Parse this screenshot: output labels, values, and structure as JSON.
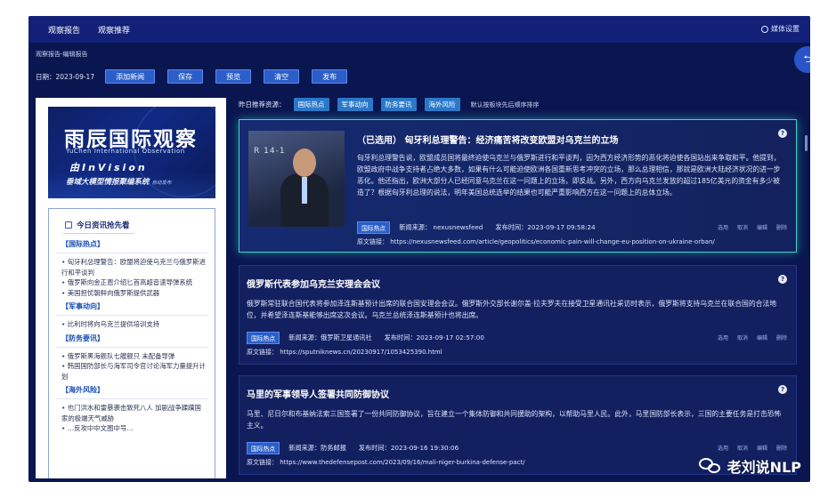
{
  "topbar": {
    "nav": [
      "观察报告",
      "观察推荐"
    ],
    "settings_label": "媒体设置"
  },
  "breadcrumb": "观察报告-编辑报告",
  "toolbar": {
    "date_label": "日期：2023-09-17",
    "buttons": [
      "添加新闻",
      "保存",
      "预览",
      "清空",
      "发布"
    ]
  },
  "banner": {
    "title": "雨辰国际观察",
    "subtitle": "YuChen International Observation",
    "invision": "由InVision",
    "desc": "垂域大模型情报聚编系统",
    "desc_small": "自动发布"
  },
  "sidebar": {
    "heading": "今日资讯抢先看",
    "categories": [
      {
        "name": "【国际热点】",
        "items": [
          "匈牙利总理警告：欧盟将迫使乌克兰与俄罗斯进行和平谈判",
          "俄罗斯向金正恩介绍匕首高超音速导弹系统",
          "美国担忧朝鲜向俄罗斯提供武器"
        ]
      },
      {
        "name": "【军事动向】",
        "items": [
          "比利时将向乌克兰提供培训支持"
        ]
      },
      {
        "name": "【防务要讯】",
        "items": [
          "俄罗斯黑海舰队七艘舰只 未配备导弹",
          "韩国国防部长与海军司令官讨论海军力量提升计划"
        ]
      },
      {
        "name": "【海外风险】",
        "items": [
          "也门洪水和雷暴袭击致死八人 加剧战争蹂躏国家的极端天气威胁",
          "…反攻中中文图中号…"
        ]
      }
    ]
  },
  "filter": {
    "label": "昨日推荐资源：",
    "tags": [
      "国际热点",
      "军事动向",
      "防务要讯",
      "海外风险"
    ],
    "hint": "默认按板块先后顺序排序"
  },
  "cards": [
    {
      "title": "（已选用） 匈牙利总理警告：经济痛苦将改变欧盟对乌克兰的立场",
      "body": "匈牙利总理警告说，欧盟成员国将最终迫使乌克兰与俄罗斯进行和平谈判，因为西方经济形势的恶化将迫使各国站出来争取和平。他提到，欧盟政府中战争支持者占绝大多数，如果有什么可能迫使欧洲各国重新思考冲突的立场，那么总理相信，那就是欧洲大陆经济状况的进一步恶化。他还指出，欧洲大部分人已经同意乌克兰在这一问题上的立场，即反战。另外，西方向乌克兰发放的超过185亿美元的资金有多少被造了？根据匈牙利总理的说法，明年美国总统选举的结果也可能严重影响西方在这一问题上的总体立场。",
      "tag": "国际热点",
      "source": "新闻来源： nexusnewsfeed",
      "time": "发布时间：2023-09-17 09:58:24",
      "link": "原文链接： https://nexusnewsfeed.com/article/geopolitics/economic-pain-will-change-eu-position-on-ukraine-orban/",
      "actions": [
        "选用",
        "取消",
        "编辑",
        "删除"
      ],
      "photo_text": "R 14-1"
    },
    {
      "title": "俄罗斯代表参加乌克兰安理会会议",
      "body": "俄罗斯常驻联合国代表将参加泽连斯基预计出席的联合国安理会会议。俄罗斯外交部长谢尔盖·拉夫罗夫在接受卫星通讯社采访时表示，俄罗斯将支持乌克兰在联合国的合法地位，并希望泽连斯基能够出席这次会议。乌克兰总统泽连斯基预计也将出席。",
      "tag": "国际热点",
      "source": "新闻来源：俄罗斯卫星通讯社",
      "time": "发布时间：2023-09-17 02:57:00",
      "link": "原文链接： https://sputniknews.cn/20230917/1053425390.html",
      "actions": [
        "选用",
        "取消",
        "编辑",
        "删除"
      ]
    },
    {
      "title": "马里的军事领导人签署共同防御协议",
      "body": "马里、尼日尔和布基纳法索三国签署了一份共同防御协议，旨在建立一个集体防御和共同援助的架构，以帮助马里人民。此外，马里国防部长表示，三国的主要任务是打击恐怖主义。",
      "tag": "国际热点",
      "source": "新闻来源：防务邮报",
      "time": "发布时间：2023-09-16 19:30:06",
      "link": "原文链接： https://www.thedefensepost.com/2023/09/16/mali-niger-burkina-defense-pact/",
      "actions": [
        "选用",
        "取消",
        "编辑",
        "删除"
      ]
    }
  ],
  "watermark": "老刘说NLP",
  "icons": [
    "gear-icon",
    "back-icon",
    "news-icon",
    "help-icon",
    "wechat-icon"
  ]
}
